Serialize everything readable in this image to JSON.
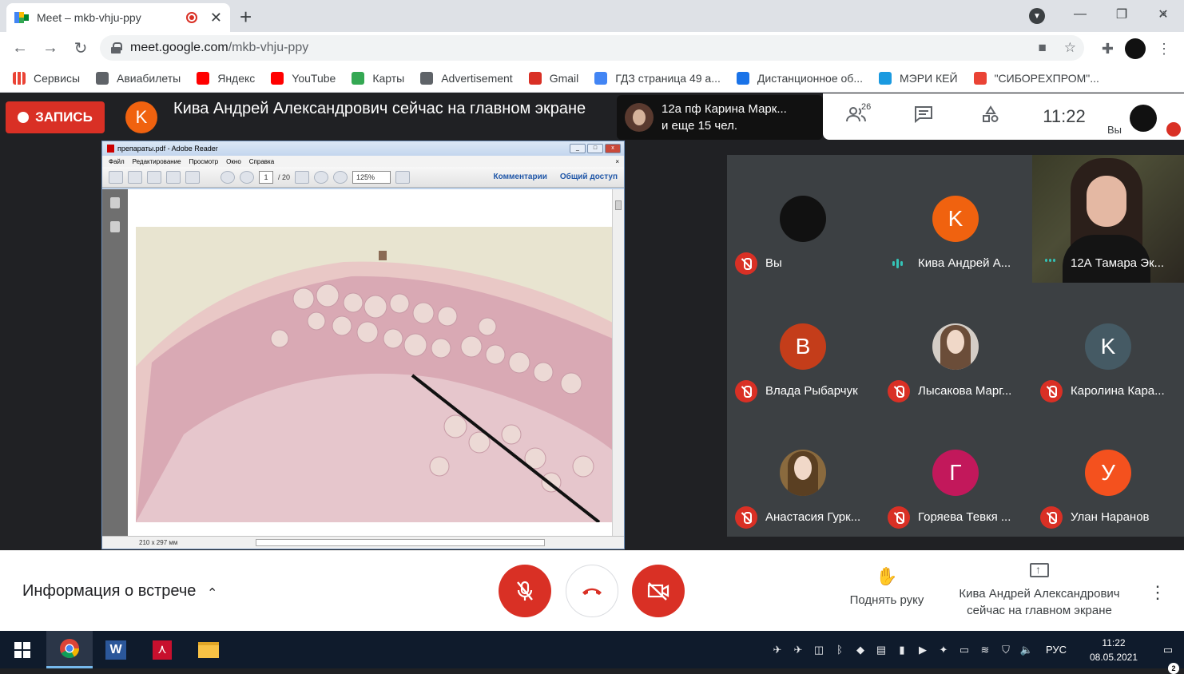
{
  "browser": {
    "tab_title": "Meet – mkb-vhju-ppy",
    "url_host": "meet.google.com",
    "url_path": "/mkb-vhju-ppy",
    "bookmarks": [
      {
        "label": "Сервисы",
        "color": "#ea4335"
      },
      {
        "label": "Авиабилеты",
        "color": "#5f6368"
      },
      {
        "label": "Яндекс",
        "color": "#ff0000"
      },
      {
        "label": "YouTube",
        "color": "#ff0000"
      },
      {
        "label": "Карты",
        "color": "#34a853"
      },
      {
        "label": "Advertisement",
        "color": "#5f6368"
      },
      {
        "label": "Gmail",
        "color": "#d93025"
      },
      {
        "label": "ГДЗ страница 49 а...",
        "color": "#4285f4"
      },
      {
        "label": "Дистанционное об...",
        "color": "#1a73e8"
      },
      {
        "label": "МЭРИ КЕЙ",
        "color": "#1a9ae0"
      },
      {
        "label": "\"СИБОРЕХПРОМ\"...",
        "color": "#ea4335"
      }
    ]
  },
  "meet": {
    "record_label": "ЗАПИСЬ",
    "presenter_initial": "K",
    "presenter_text": "Кива Андрей Александрович сейчас на главном экране",
    "others_name": "12а пф Карина Марк...",
    "others_more": "и еще 15 чел.",
    "participant_count": "26",
    "clock": "11:22",
    "you_label": "Вы",
    "participants": [
      {
        "name": "Вы",
        "initial": "",
        "color": "#111111",
        "mic": "muted"
      },
      {
        "name": "Кива Андрей А...",
        "initial": "K",
        "color": "#f0620f",
        "mic": "speaking"
      },
      {
        "name": "12А Тамара Эк...",
        "initial": "",
        "color": "",
        "mic": "camera"
      },
      {
        "name": "Влада Рыбарчук",
        "initial": "B",
        "color": "#c43d1a",
        "mic": "muted"
      },
      {
        "name": "Лысакова Марг...",
        "initial": "",
        "color": "#d4cdc6",
        "mic": "muted"
      },
      {
        "name": "Каролина Кара...",
        "initial": "K",
        "color": "#455a64",
        "mic": "muted"
      },
      {
        "name": "Анастасия Гурк...",
        "initial": "",
        "color": "#8a6a3e",
        "mic": "muted"
      },
      {
        "name": "Горяева Тевкя ...",
        "initial": "Г",
        "color": "#c2185b",
        "mic": "muted"
      },
      {
        "name": "Улан Наранов",
        "initial": "У",
        "color": "#f4511e",
        "mic": "muted"
      }
    ]
  },
  "pdf": {
    "title": "препараты.pdf - Adobe Reader",
    "menu": [
      "Файл",
      "Редактирование",
      "Просмотр",
      "Окно",
      "Справка"
    ],
    "page_current": "1",
    "page_total": "/ 20",
    "zoom": "125%",
    "link_comments": "Комментарии",
    "link_share": "Общий доступ",
    "page_size": "210 x 297 мм"
  },
  "controls": {
    "meeting_info": "Информация о встрече",
    "raise_hand": "Поднять руку",
    "presenting": "Кива Андрей Александрович сейчас на главном экране"
  },
  "taskbar": {
    "lang": "РУС",
    "time": "11:22",
    "date": "08.05.2021",
    "notifications": "2"
  }
}
